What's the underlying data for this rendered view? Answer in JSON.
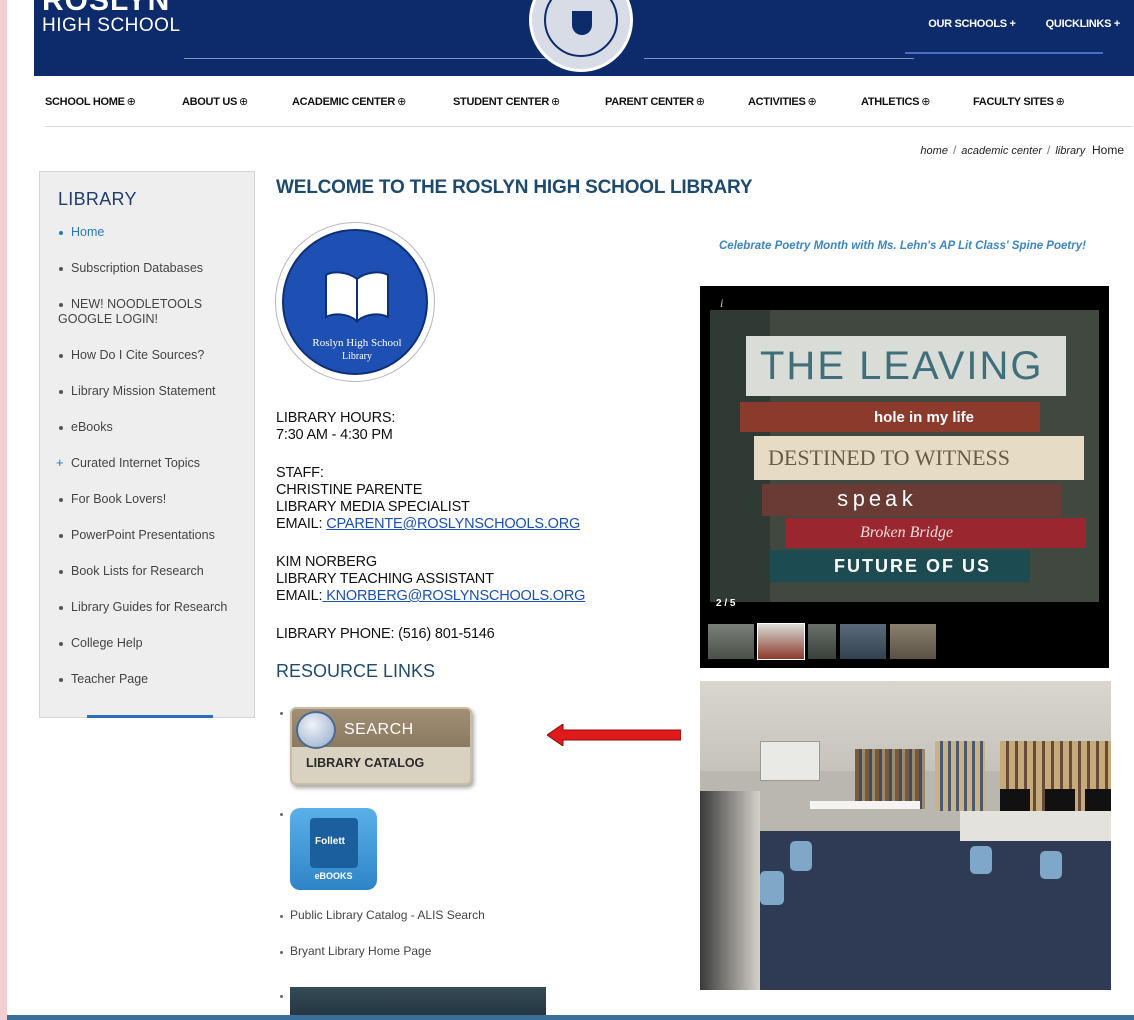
{
  "header": {
    "brand_line1": "ROSLYN",
    "brand_line2": "HIGH SCHOOL",
    "our_schools": "OUR SCHOOLS +",
    "quicklinks": "QUICKLINKS +"
  },
  "mainnav": [
    {
      "label": "SCHOOL HOME"
    },
    {
      "label": "ABOUT US"
    },
    {
      "label": "ACADEMIC CENTER"
    },
    {
      "label": "STUDENT CENTER"
    },
    {
      "label": "PARENT CENTER"
    },
    {
      "label": "ACTIVITIES"
    },
    {
      "label": "ATHLETICS"
    },
    {
      "label": "FACULTY SITES"
    }
  ],
  "nav_glyph": "⊕",
  "breadcrumb": {
    "home": "home",
    "academic": "academic center",
    "library": "library",
    "current": "Home",
    "sep": "/"
  },
  "sidebar": {
    "title": "LIBRARY",
    "items": [
      {
        "label": "Home"
      },
      {
        "label": "Subscription Databases"
      },
      {
        "label": "NEW! NOODLETOOLS GOOGLE LOGIN!"
      },
      {
        "label": "How Do I Cite Sources?"
      },
      {
        "label": "Library Mission Statement"
      },
      {
        "label": "eBooks"
      },
      {
        "label": "Curated Internet Topics"
      },
      {
        "label": "For Book Lovers!"
      },
      {
        "label": "PowerPoint Presentations"
      },
      {
        "label": "Book Lists for Research"
      },
      {
        "label": "Library Guides for Research"
      },
      {
        "label": "College Help"
      },
      {
        "label": "Teacher Page"
      }
    ]
  },
  "main": {
    "title": "WELCOME TO THE ROSLYN HIGH SCHOOL LIBRARY",
    "logo_line1": "Roslyn High School",
    "logo_line2": "Library",
    "hours_label": "LIBRARY HOURS:",
    "hours": "7:30 AM  -  4:30 PM",
    "staff_label": "STAFF:",
    "staff1_name": "CHRISTINE PARENTE",
    "staff1_role": "LIBRARY MEDIA SPECIALIST",
    "email_label": "EMAIL:",
    "staff1_email": "CPARENTE@ROSLYNSCHOOLS.ORG",
    "staff2_name": "KIM NORBERG",
    "staff2_role": "LIBRARY TEACHING ASSISTANT",
    "staff2_email": "KNORBERG@ROSLYNSCHOOLS.ORG",
    "phone": "LIBRARY PHONE: (516) 801-5146",
    "resources_heading": "RESOURCE LINKS",
    "search_word": "SEARCH",
    "catalog_word": "LIBRARY CATALOG",
    "follett_word": "Follett",
    "ebooks_word": "eBOOKS",
    "link1": "Public Library Catalog - ALIS Search",
    "link2": "Bryant Library Home Page"
  },
  "right": {
    "caption": "Celebrate Poetry Month with Ms. Lehn's AP Lit Class' Spine Poetry!",
    "slide_count": "2 / 5",
    "slide_info": "i",
    "books": [
      {
        "text": "THE LEAVING",
        "color": "#d9dcd7",
        "fg": "#3f6f7b"
      },
      {
        "text": "hole in my life",
        "color": "#8c3a2c",
        "fg": "#ffffff"
      },
      {
        "text": "DESTINED TO WITNESS",
        "color": "#e6dcc6",
        "fg": "#6b5b44"
      },
      {
        "text": "speak",
        "color": "#6a3b34",
        "fg": "#ffffff"
      },
      {
        "text": "Broken Bridge",
        "color": "#9a2630",
        "fg": "#f4dede"
      },
      {
        "text": "FUTURE OF US",
        "color": "#1d4b52",
        "fg": "#ffffff"
      }
    ]
  },
  "colors": {
    "navy": "#0d2a6b",
    "title_blue": "#1f4a70",
    "link_blue": "#2a7ab8",
    "arrow_red": "#e01a1a"
  }
}
